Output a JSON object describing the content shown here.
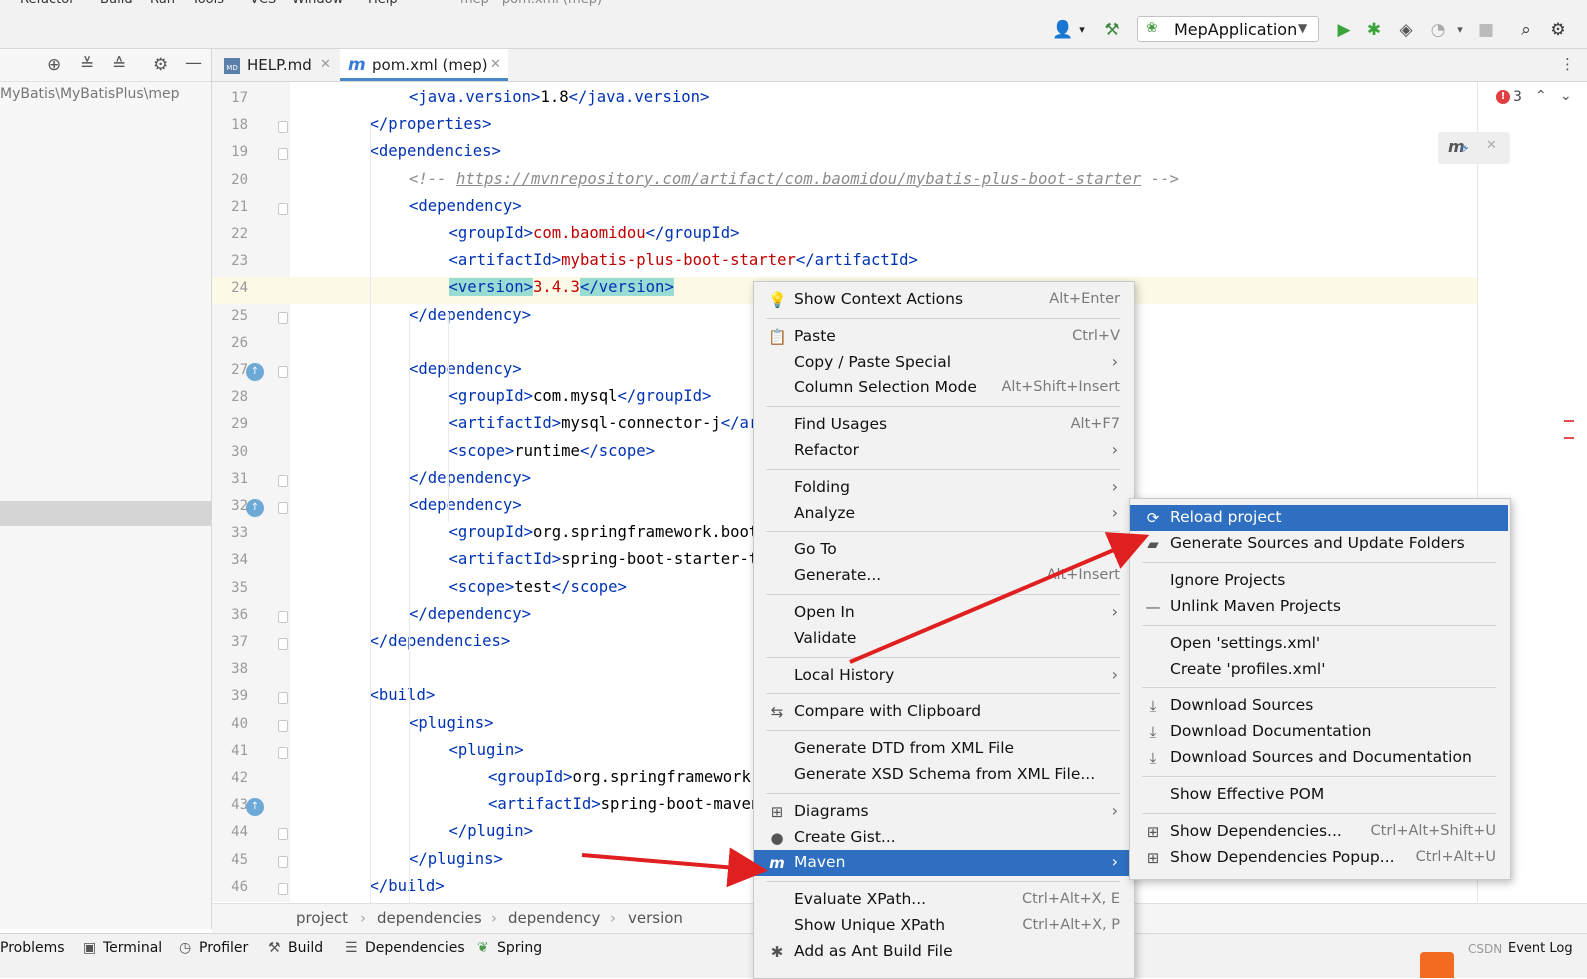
{
  "menubar": {
    "items": [
      "Refactor",
      "Build",
      "Run",
      "Tools",
      "VCS",
      "Window",
      "Help"
    ],
    "title": "mep - pom.xml (mep)"
  },
  "toolbar": {
    "run_config": "MepApplication"
  },
  "project_panel": {
    "path": "MyBatis\\MyBatisPlus\\mep"
  },
  "tabs": [
    {
      "label": "HELP.md",
      "icon_text": "MD"
    },
    {
      "label": "pom.xml (mep)",
      "icon_text": "m"
    }
  ],
  "editor": {
    "problems_count": "3",
    "lines": [
      {
        "n": "17",
        "indent": 2,
        "parts": [
          [
            "tag",
            "<java.version>"
          ],
          [
            "txt",
            "1.8"
          ],
          [
            "tag",
            "</java.version>"
          ]
        ]
      },
      {
        "n": "18",
        "indent": 1,
        "parts": [
          [
            "tag",
            "</properties>"
          ]
        ]
      },
      {
        "n": "19",
        "indent": 1,
        "parts": [
          [
            "tag",
            "<dependencies>"
          ]
        ]
      },
      {
        "n": "20",
        "indent": 2,
        "parts": [
          [
            "cmt",
            "<!-- "
          ],
          [
            "url",
            "https://mvnrepository.com/artifact/com.baomidou/mybatis-plus-boot-starter"
          ],
          [
            "cmt",
            " -->"
          ]
        ]
      },
      {
        "n": "21",
        "indent": 2,
        "parts": [
          [
            "tag",
            "<dependency>"
          ]
        ]
      },
      {
        "n": "22",
        "indent": 3,
        "parts": [
          [
            "tag",
            "<groupId>"
          ],
          [
            "val",
            "com.baomidou"
          ],
          [
            "tag",
            "</groupId>"
          ]
        ]
      },
      {
        "n": "23",
        "indent": 3,
        "parts": [
          [
            "tag",
            "<artifactId>"
          ],
          [
            "val",
            "mybatis-plus-boot-starter"
          ],
          [
            "tag",
            "</artifactId>"
          ]
        ]
      },
      {
        "n": "24",
        "indent": 3,
        "parts": [
          [
            "hltag",
            "<version>"
          ],
          [
            "val",
            "3.4.3"
          ],
          [
            "hltag",
            "</version>"
          ]
        ]
      },
      {
        "n": "25",
        "indent": 2,
        "parts": [
          [
            "tag",
            "</dependency>"
          ]
        ]
      },
      {
        "n": "26",
        "indent": 0,
        "parts": []
      },
      {
        "n": "27",
        "indent": 2,
        "parts": [
          [
            "tag",
            "<dependency>"
          ]
        ]
      },
      {
        "n": "28",
        "indent": 3,
        "parts": [
          [
            "tag",
            "<groupId>"
          ],
          [
            "txt",
            "com.mysql"
          ],
          [
            "tag",
            "</groupId>"
          ]
        ]
      },
      {
        "n": "29",
        "indent": 3,
        "parts": [
          [
            "tag",
            "<artifactId>"
          ],
          [
            "txt",
            "mysql-connector-j"
          ],
          [
            "tag",
            "</arti"
          ]
        ]
      },
      {
        "n": "30",
        "indent": 3,
        "parts": [
          [
            "tag",
            "<scope>"
          ],
          [
            "txt",
            "runtime"
          ],
          [
            "tag",
            "</scope>"
          ]
        ]
      },
      {
        "n": "31",
        "indent": 2,
        "parts": [
          [
            "tag",
            "</dependency>"
          ]
        ]
      },
      {
        "n": "32",
        "indent": 2,
        "parts": [
          [
            "tag",
            "<dependency>"
          ]
        ]
      },
      {
        "n": "33",
        "indent": 3,
        "parts": [
          [
            "tag",
            "<groupId>"
          ],
          [
            "txt",
            "org.springframework.boot"
          ],
          [
            "tag",
            "</"
          ]
        ]
      },
      {
        "n": "34",
        "indent": 3,
        "parts": [
          [
            "tag",
            "<artifactId>"
          ],
          [
            "txt",
            "spring-boot-starter-tes"
          ]
        ]
      },
      {
        "n": "35",
        "indent": 3,
        "parts": [
          [
            "tag",
            "<scope>"
          ],
          [
            "txt",
            "test"
          ],
          [
            "tag",
            "</scope>"
          ]
        ]
      },
      {
        "n": "36",
        "indent": 2,
        "parts": [
          [
            "tag",
            "</dependency>"
          ]
        ]
      },
      {
        "n": "37",
        "indent": 1,
        "parts": [
          [
            "tag",
            "</dependencies>"
          ]
        ]
      },
      {
        "n": "38",
        "indent": 0,
        "parts": []
      },
      {
        "n": "39",
        "indent": 1,
        "parts": [
          [
            "tag",
            "<build>"
          ]
        ]
      },
      {
        "n": "40",
        "indent": 2,
        "parts": [
          [
            "tag",
            "<plugins>"
          ]
        ]
      },
      {
        "n": "41",
        "indent": 3,
        "parts": [
          [
            "tag",
            "<plugin>"
          ]
        ]
      },
      {
        "n": "42",
        "indent": 4,
        "parts": [
          [
            "tag",
            "<groupId>"
          ],
          [
            "txt",
            "org.springframework.bo"
          ]
        ]
      },
      {
        "n": "43",
        "indent": 4,
        "parts": [
          [
            "tag",
            "<artifactId>"
          ],
          [
            "txt",
            "spring-boot-maven-p"
          ]
        ]
      },
      {
        "n": "44",
        "indent": 3,
        "parts": [
          [
            "tag",
            "</plugin>"
          ]
        ]
      },
      {
        "n": "45",
        "indent": 2,
        "parts": [
          [
            "tag",
            "</plugins>"
          ]
        ]
      },
      {
        "n": "46",
        "indent": 1,
        "parts": [
          [
            "tag",
            "</build>"
          ]
        ]
      }
    ]
  },
  "breadcrumb": [
    "project",
    "dependencies",
    "dependency",
    "version"
  ],
  "bottom_tools": [
    "Problems",
    "Terminal",
    "Profiler",
    "Build",
    "Dependencies",
    "Spring"
  ],
  "bottom_right": {
    "watermark": "CSDN",
    "event_log": "Event Log"
  },
  "context_menu": {
    "items": [
      {
        "label": "Show Context Actions",
        "shortcut": "Alt+Enter",
        "icon": "bulb-icon",
        "glyph": "💡"
      },
      {
        "sep": true
      },
      {
        "label": "Paste",
        "shortcut": "Ctrl+V",
        "icon": "clipboard-icon",
        "glyph": "📋"
      },
      {
        "label": "Copy / Paste Special",
        "submenu": true
      },
      {
        "label": "Column Selection Mode",
        "shortcut": "Alt+Shift+Insert"
      },
      {
        "sep": true
      },
      {
        "label": "Find Usages",
        "shortcut": "Alt+F7"
      },
      {
        "label": "Refactor",
        "submenu": true
      },
      {
        "sep": true
      },
      {
        "label": "Folding",
        "submenu": true
      },
      {
        "label": "Analyze",
        "submenu": true
      },
      {
        "sep": true
      },
      {
        "label": "Go To",
        "submenu": true
      },
      {
        "label": "Generate...",
        "shortcut": "Alt+Insert"
      },
      {
        "sep": true
      },
      {
        "label": "Open In",
        "submenu": true
      },
      {
        "label": "Validate"
      },
      {
        "sep": true
      },
      {
        "label": "Local History",
        "submenu": true
      },
      {
        "sep": true
      },
      {
        "label": "Compare with Clipboard",
        "icon": "compare-icon",
        "glyph": "⇆"
      },
      {
        "sep": true
      },
      {
        "label": "Generate DTD from XML File"
      },
      {
        "label": "Generate XSD Schema from XML File..."
      },
      {
        "sep": true
      },
      {
        "label": "Diagrams",
        "submenu": true,
        "icon": "diagram-icon",
        "glyph": "⊞"
      },
      {
        "label": "Create Gist...",
        "icon": "github-icon",
        "glyph": "●"
      },
      {
        "label": "Maven",
        "submenu": true,
        "selected": true,
        "icon": "maven-icon",
        "glyph": "m"
      },
      {
        "sep": true
      },
      {
        "label": "Evaluate XPath...",
        "shortcut": "Ctrl+Alt+X, E"
      },
      {
        "label": "Show Unique XPath",
        "shortcut": "Ctrl+Alt+X, P"
      },
      {
        "label": "Add as Ant Build File",
        "icon": "ant-icon",
        "glyph": "✱"
      }
    ]
  },
  "maven_submenu": {
    "items": [
      {
        "label": "Reload project",
        "selected": true,
        "icon": "reload-icon",
        "glyph": "⟳"
      },
      {
        "label": "Generate Sources and Update Folders",
        "icon": "folder-refresh-icon",
        "glyph": "▰"
      },
      {
        "sep": true
      },
      {
        "label": "Ignore Projects"
      },
      {
        "label": "Unlink Maven Projects",
        "icon": "minus-icon",
        "glyph": "—"
      },
      {
        "sep": true
      },
      {
        "label": "Open 'settings.xml'"
      },
      {
        "label": "Create 'profiles.xml'"
      },
      {
        "sep": true
      },
      {
        "label": "Download Sources",
        "icon": "download-icon",
        "glyph": "⤓"
      },
      {
        "label": "Download Documentation",
        "icon": "download-icon",
        "glyph": "⤓"
      },
      {
        "label": "Download Sources and Documentation",
        "icon": "download-icon",
        "glyph": "⤓"
      },
      {
        "sep": true
      },
      {
        "label": "Show Effective POM"
      },
      {
        "sep": true
      },
      {
        "label": "Show Dependencies...",
        "shortcut": "Ctrl+Alt+Shift+U",
        "icon": "dependencies-icon",
        "glyph": "⊞"
      },
      {
        "label": "Show Dependencies Popup...",
        "shortcut": "Ctrl+Alt+U",
        "icon": "dependencies-icon",
        "glyph": "⊞"
      }
    ]
  },
  "colors": {
    "selection": "#2f6fc1",
    "annotation_arrow": "#e02020",
    "xml_tag": "#0033b3",
    "xml_value": "#c00000"
  }
}
